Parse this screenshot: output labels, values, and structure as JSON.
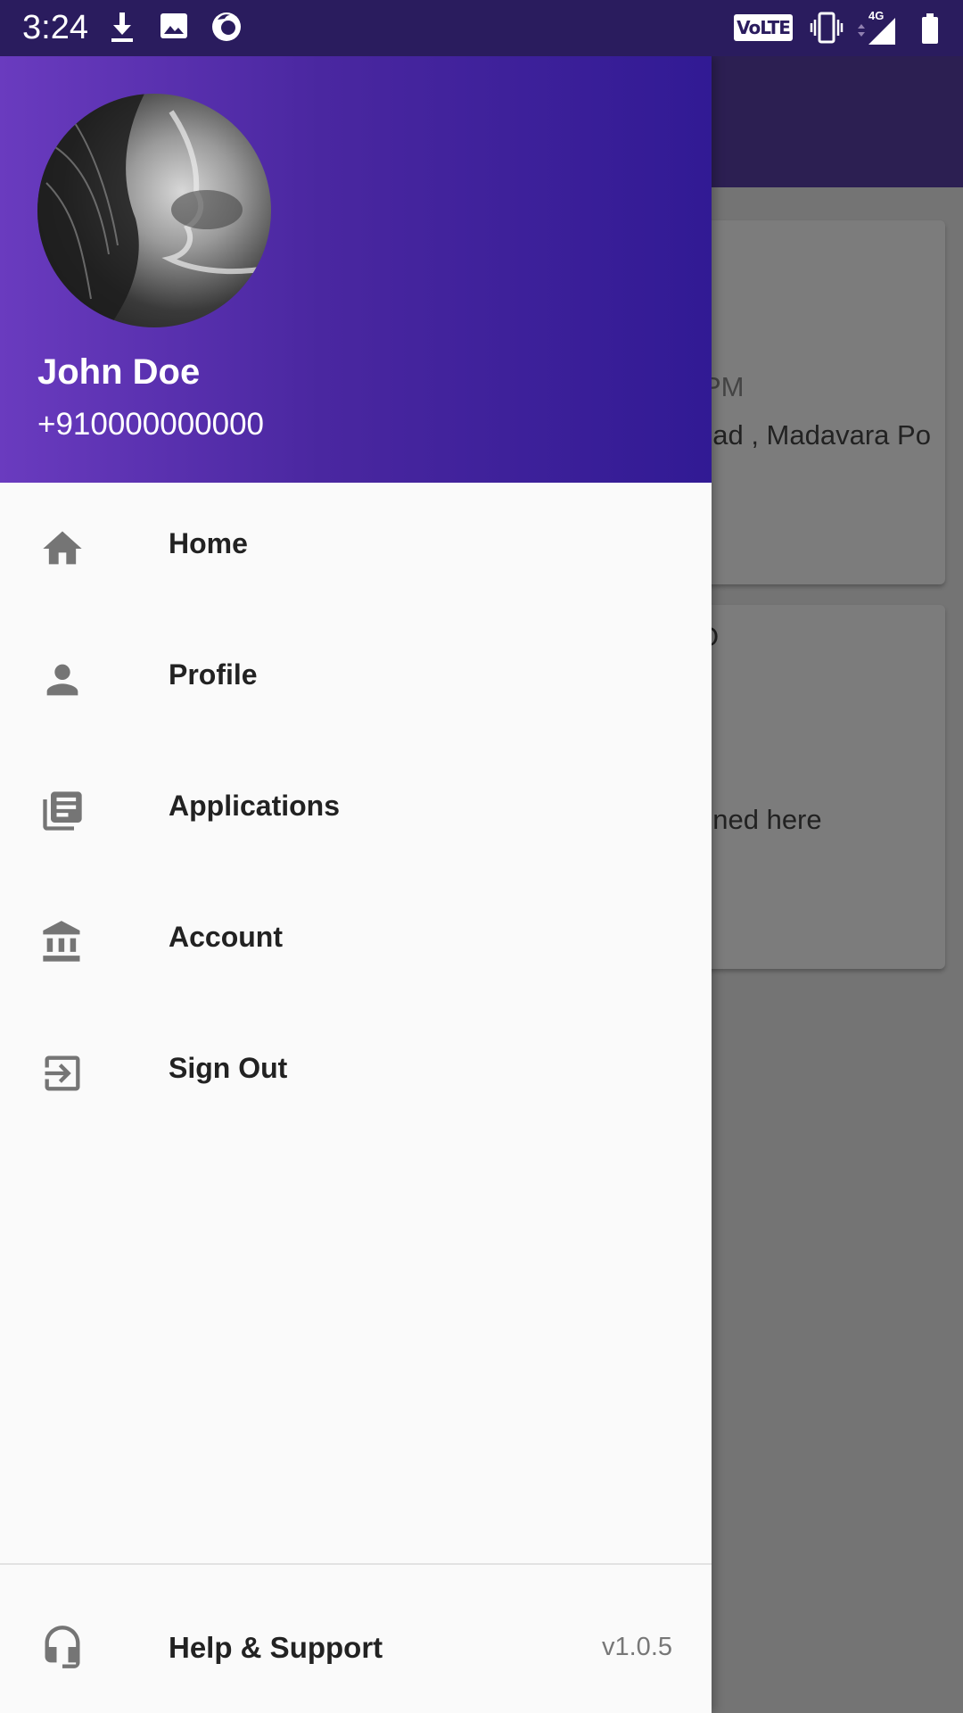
{
  "status_bar": {
    "time": "3:24",
    "icons": [
      "download-icon",
      "image-icon",
      "firefox-icon",
      "volte-icon",
      "vibrate-icon",
      "signal-4g-icon",
      "battery-icon"
    ],
    "volte_label": "VoLTE",
    "network_label": "4G"
  },
  "background": {
    "card1_line1": "PM",
    "card1_line2": "oad , Madavara Po",
    "card2_line1": "O",
    "card2_line2": "oned here"
  },
  "drawer": {
    "user": {
      "name": "John Doe",
      "phone": "+910000000000"
    },
    "menu": [
      {
        "label": "Home",
        "icon": "home-icon"
      },
      {
        "label": "Profile",
        "icon": "person-icon"
      },
      {
        "label": "Applications",
        "icon": "library-books-icon"
      },
      {
        "label": "Account",
        "icon": "bank-icon"
      },
      {
        "label": "Sign Out",
        "icon": "exit-icon"
      }
    ],
    "footer": {
      "label": "Help & Support",
      "icon": "headset-icon",
      "version": "v1.0.5"
    }
  },
  "colors": {
    "header_gradient_start": "#6a3bbf",
    "header_gradient_end": "#311a94",
    "status_bar": "#2a1c5e",
    "scrim": "#747474"
  }
}
